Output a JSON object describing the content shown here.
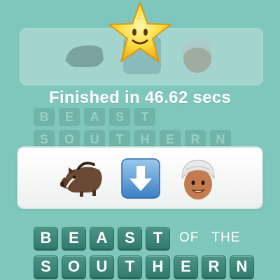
{
  "status": {
    "finished_text": "Finished in 46.62 secs"
  },
  "icons": {
    "star": "smiling-star-icon",
    "clue_1": "boar-icon",
    "clue_2": "down-arrow-icon",
    "clue_3": "man-with-turban-icon"
  },
  "colors": {
    "background": "#7fc7bc",
    "tile": "#3f8a7c",
    "card": "#ffffff",
    "text": "#ffffff"
  },
  "answer": {
    "line1": {
      "tiles1": [
        "B",
        "E",
        "A",
        "S",
        "T"
      ],
      "plain1": "OF",
      "plain2": "THE"
    },
    "line2": {
      "tiles": [
        "S",
        "O",
        "U",
        "T",
        "H",
        "E",
        "R",
        "N"
      ]
    }
  },
  "background_answer": {
    "line1": [
      "B",
      "E",
      "A",
      "S",
      "T"
    ],
    "line2": [
      "S",
      "O",
      "U",
      "T",
      "H",
      "E",
      "R",
      "N"
    ]
  }
}
